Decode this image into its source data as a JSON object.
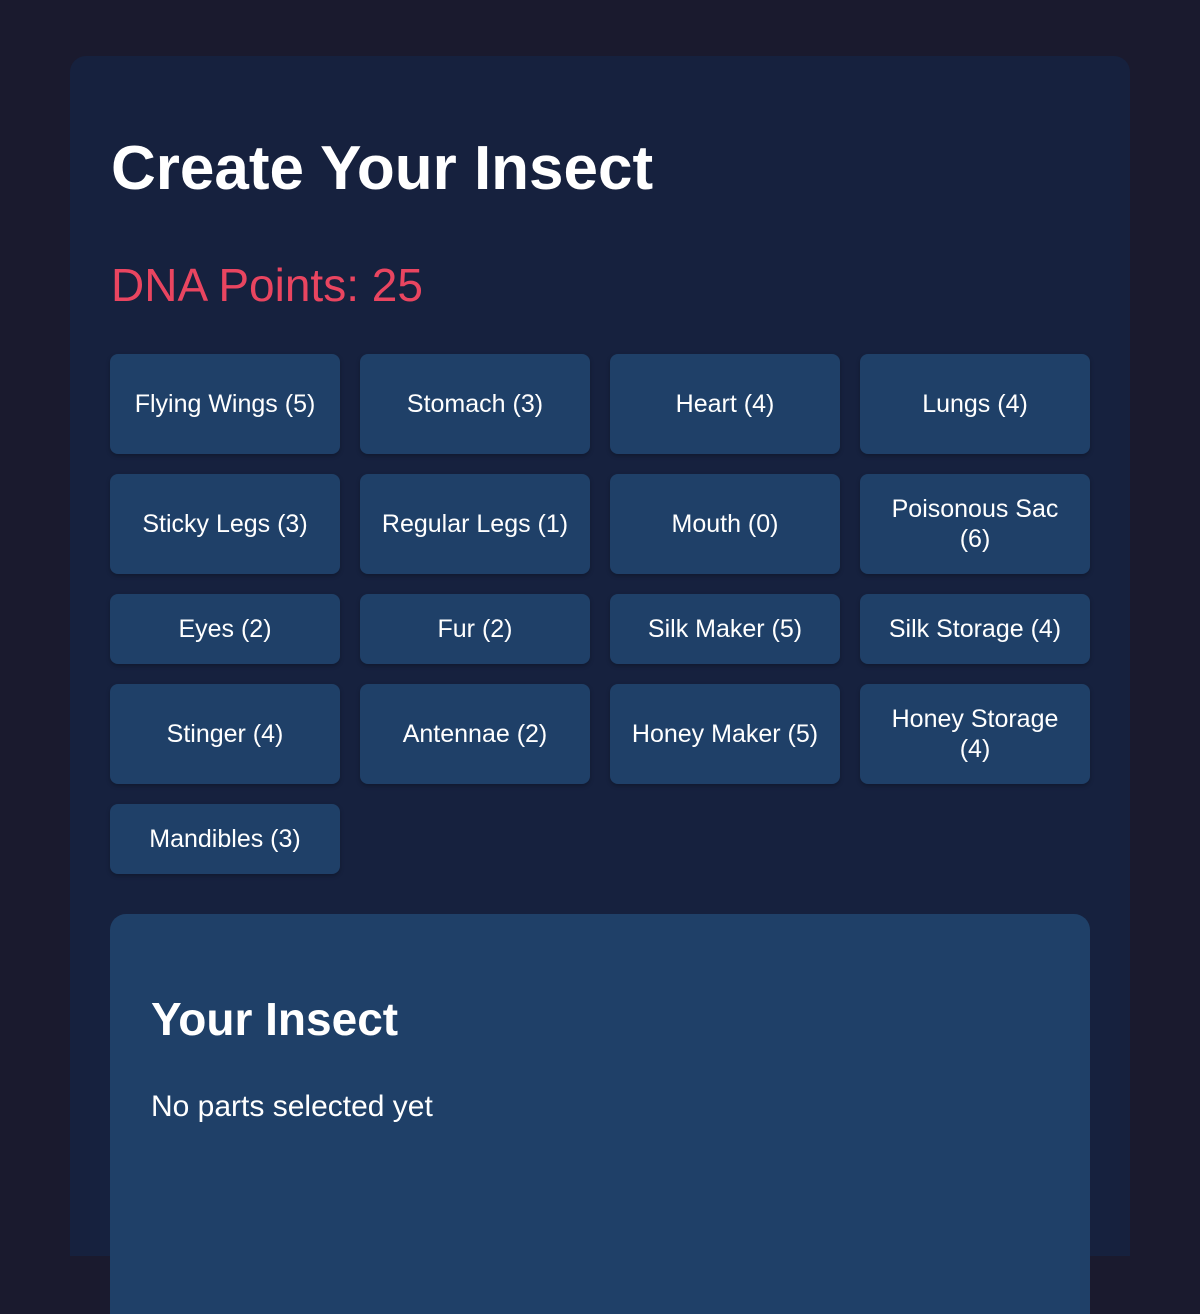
{
  "title": "Create Your Insect",
  "dna": {
    "label": "DNA Points: 25"
  },
  "parts": [
    {
      "label": "Flying Wings (5)"
    },
    {
      "label": "Stomach (3)"
    },
    {
      "label": "Heart (4)"
    },
    {
      "label": "Lungs (4)"
    },
    {
      "label": "Sticky Legs (3)"
    },
    {
      "label": "Regular Legs (1)"
    },
    {
      "label": "Mouth (0)"
    },
    {
      "label": "Poisonous Sac (6)"
    },
    {
      "label": "Eyes (2)"
    },
    {
      "label": "Fur (2)"
    },
    {
      "label": "Silk Maker (5)"
    },
    {
      "label": "Silk Storage (4)"
    },
    {
      "label": "Stinger (4)"
    },
    {
      "label": "Antennae (2)"
    },
    {
      "label": "Honey Maker (5)"
    },
    {
      "label": "Honey Storage (4)"
    },
    {
      "label": "Mandibles (3)"
    }
  ],
  "insect": {
    "title": "Your Insect",
    "empty_text": "No parts selected yet"
  },
  "colors": {
    "page_background": "#1a1a2e",
    "panel_background": "#16213e",
    "button_background": "#1f4068",
    "accent": "#e94560",
    "text": "#ffffff"
  }
}
